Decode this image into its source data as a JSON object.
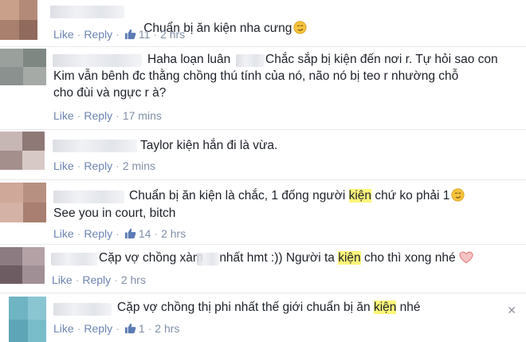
{
  "actions": {
    "like": "Like",
    "reply": "Reply",
    "dot": "·"
  },
  "comments": [
    {
      "text": "Chuẩn bị ăn kiện nha cưng",
      "likes": "11",
      "time": "2 hrs"
    },
    {
      "line1": "Haha loạn luân",
      "line1b": "Chắc sắp bị kiện đến nơi r. Tự hỏi sao con",
      "line2": "Kim vẫn bênh đc thằng chồng thú tính của nó, não nó bị teo r nhường chỗ",
      "line3": "cho đùi và ngực r à?",
      "time": "17 mins"
    },
    {
      "text": "Taylor kiện hắn đi là vừa.",
      "time": "2 mins"
    },
    {
      "pre": "Chuẩn bị ăn kiện là chắc, 1 đống người ",
      "hl": "kiện",
      "post": " chứ ko phải 1",
      "line2": "See you in court, bitch",
      "likes": "14",
      "time": "2 hrs"
    },
    {
      "pre": "Cặp vợ chồng xàm",
      "mid": " nhất hmt :)) Người ta ",
      "hl": "kiện",
      "post": " cho thì xong nhé",
      "time": "2 hrs"
    },
    {
      "pre": "Cặp vợ chồng thị phi nhất thế giới chuẩn bị ăn ",
      "hl": "kiện",
      "post": " nhé",
      "likes": "1",
      "time": "2 hrs",
      "close": "✕"
    }
  ],
  "colors": {
    "link": "#6d84b4",
    "meta": "#7f8fa8",
    "highlight": "#fdf57a"
  }
}
